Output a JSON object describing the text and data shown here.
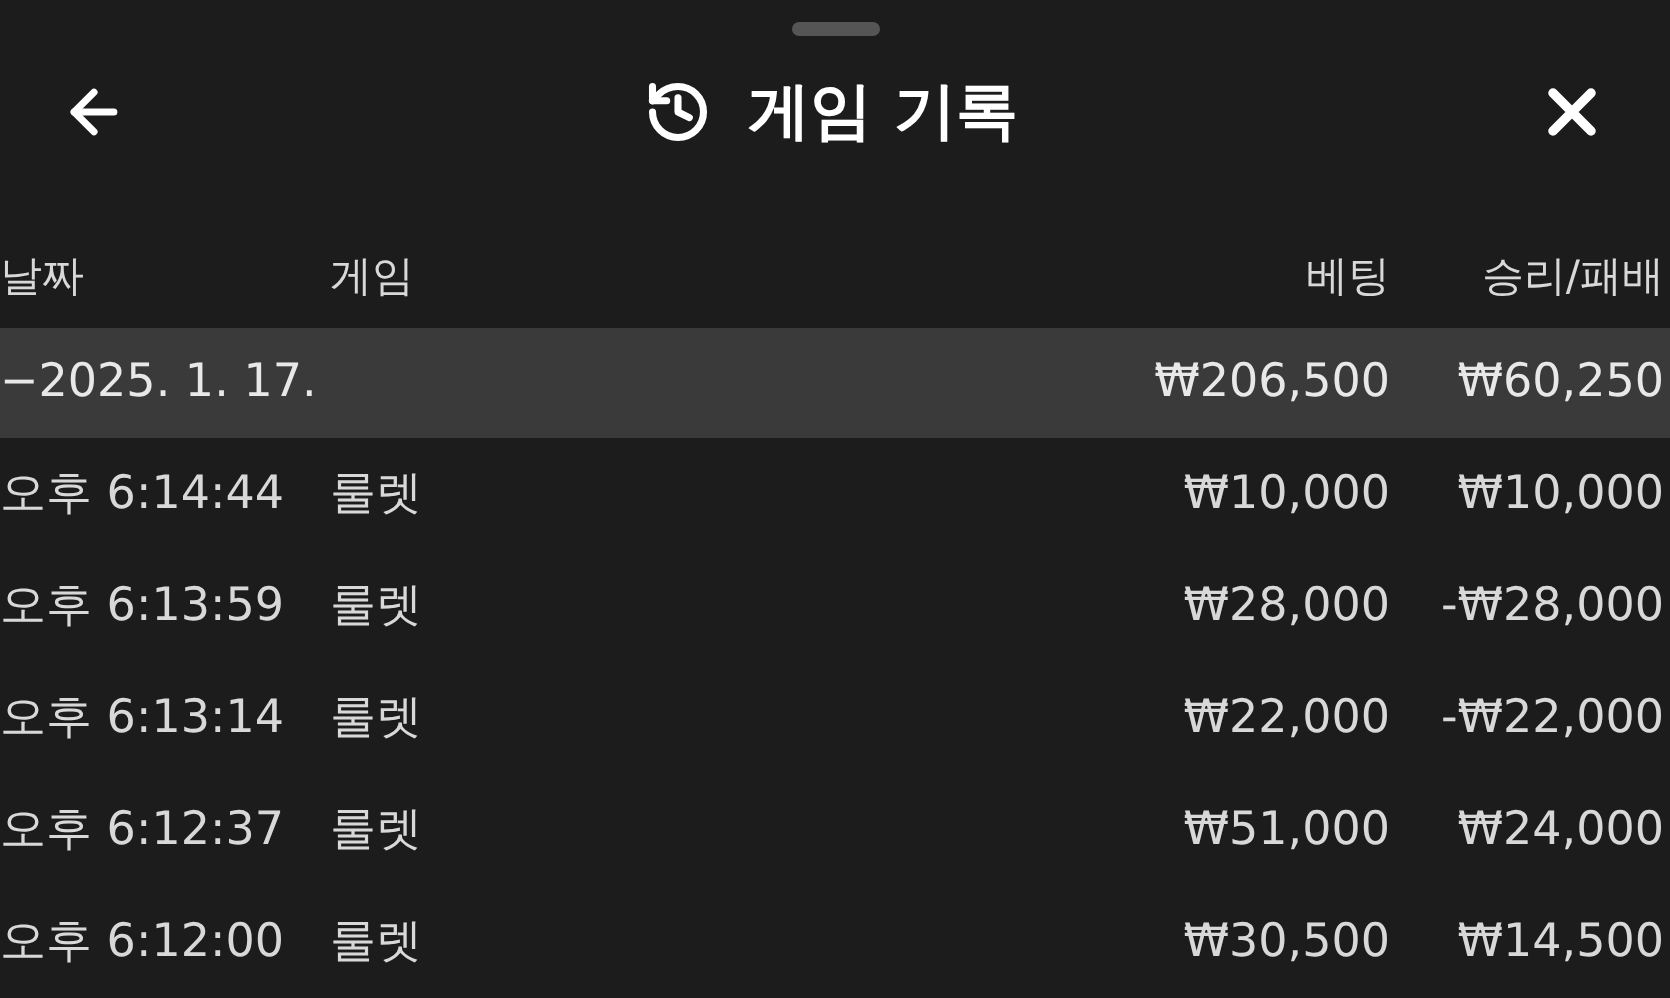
{
  "header": {
    "title": "게임 기록"
  },
  "table": {
    "columns": [
      "날짜",
      "게임",
      "베팅",
      "승리/패배"
    ],
    "groups": [
      {
        "toggle": "−",
        "date": "2025. 1. 17.",
        "bet": "₩206,500",
        "result": "₩60,250",
        "rows": [
          {
            "time": "오후 6:14:44",
            "game": "룰렛",
            "bet": "₩10,000",
            "result": "₩10,000"
          },
          {
            "time": "오후 6:13:59",
            "game": "룰렛",
            "bet": "₩28,000",
            "result": "-₩28,000"
          },
          {
            "time": "오후 6:13:14",
            "game": "룰렛",
            "bet": "₩22,000",
            "result": "-₩22,000"
          },
          {
            "time": "오후 6:12:37",
            "game": "룰렛",
            "bet": "₩51,000",
            "result": "₩24,000"
          },
          {
            "time": "오후 6:12:00",
            "game": "룰렛",
            "bet": "₩30,500",
            "result": "₩14,500"
          }
        ]
      }
    ]
  }
}
